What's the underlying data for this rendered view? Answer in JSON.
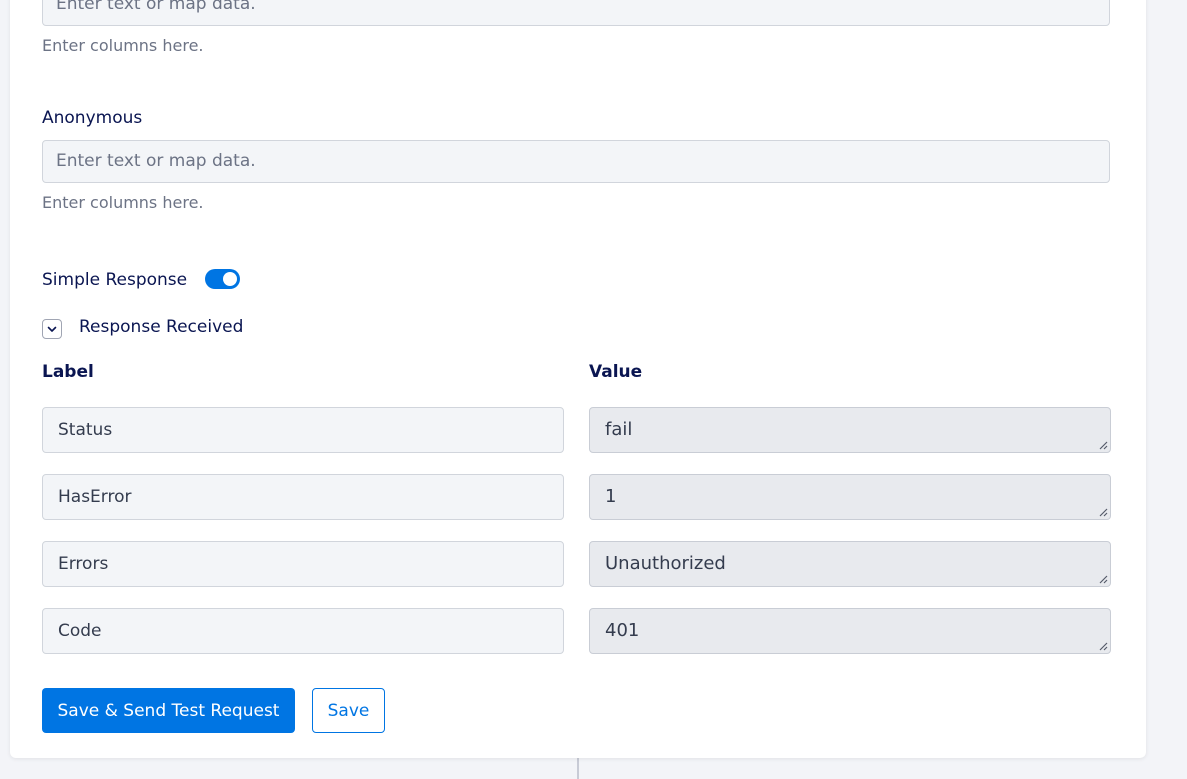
{
  "fields": [
    {
      "label": "",
      "placeholder": "Enter text or map data.",
      "helper": "Enter columns here."
    },
    {
      "label": "Anonymous",
      "placeholder": "Enter text or map data.",
      "helper": "Enter columns here."
    }
  ],
  "simple_response": {
    "label": "Simple Response",
    "enabled": true
  },
  "response_received": {
    "title": "Response Received",
    "expanded": true,
    "label_header": "Label",
    "value_header": "Value",
    "rows": [
      {
        "label": "Status",
        "value": "fail"
      },
      {
        "label": "HasError",
        "value": "1"
      },
      {
        "label": "Errors",
        "value": "Unauthorized"
      },
      {
        "label": "Code",
        "value": "401"
      }
    ]
  },
  "actions": {
    "save_and_send_label": "Save & Send Test Request",
    "save_label": "Save"
  },
  "colors": {
    "accent": "#0075e3",
    "text": "#0a1551",
    "muted": "#6c7385"
  }
}
